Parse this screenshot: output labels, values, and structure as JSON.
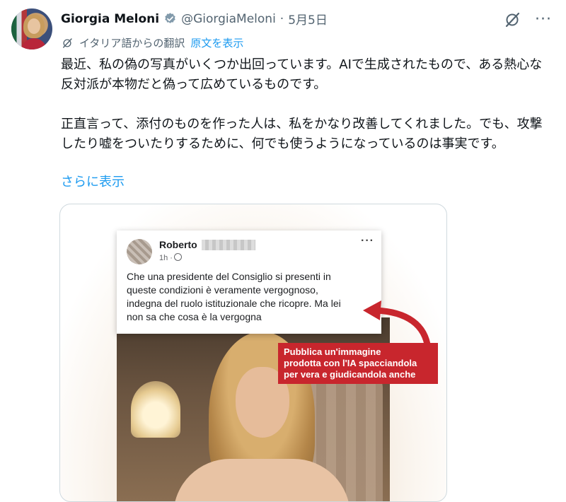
{
  "tweet": {
    "author_name": "Giorgia Meloni",
    "handle": "@GiorgiaMeloni",
    "separator": "·",
    "date": "5月5日",
    "translation_note": "イタリア語からの翻訳",
    "show_original": "原文を表示",
    "paragraphs": [
      "最近、私の偽の写真がいくつか出回っています。AIで生成されたもので、ある熱心な反対派が本物だと偽って広めているものです。",
      "正直言って、添付のものを作った人は、私をかなり改善してくれました。でも、攻撃したり嘘をついたりするために、何でも使うようになっているのは事実です。"
    ],
    "show_more": "さらに表示",
    "more_icon": "···"
  },
  "embedded_post": {
    "poster_name": "Roberto",
    "time": "1h ·",
    "more": "···",
    "lines": [
      "Che una presidente del Consiglio  si presenti in",
      "queste condizioni è veramente vergognoso,",
      "indegna del ruolo istituzionale che ricopre. Ma lei",
      "non sa che cosa è la vergogna"
    ]
  },
  "caption_label": {
    "lines": [
      "Pubblica un'immagine",
      "prodotta con l'IA spacciandola",
      "per vera e giudicandola anche"
    ]
  },
  "colors": {
    "link": "#1d9bf0",
    "secondary": "#536471",
    "label_red": "#c8262d"
  },
  "icons": [
    "verified-badge-icon",
    "grok-icon",
    "more-icon",
    "translate-icon",
    "globe-icon",
    "arrow-icon"
  ]
}
